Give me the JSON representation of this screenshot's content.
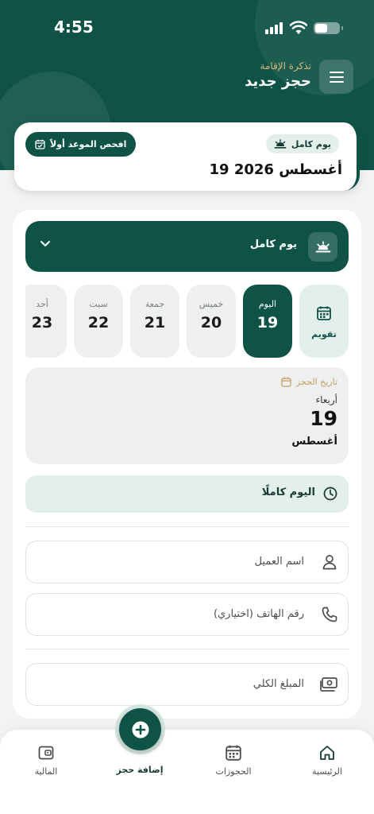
{
  "status_bar": {
    "time": "4:55"
  },
  "header": {
    "subtitle": "تذكرة الإقامة",
    "title": "حجز جديد"
  },
  "summary": {
    "chip_label": "يوم كامل",
    "check_button": "افحص الموعد أولاً",
    "date": "19 أغسطس 2026"
  },
  "booking_type": {
    "label": "يوم كامل"
  },
  "days": [
    {
      "name": "تقويم",
      "number": ""
    },
    {
      "name": "اليوم",
      "number": "19"
    },
    {
      "name": "خميس",
      "number": "20"
    },
    {
      "name": "جمعة",
      "number": "21"
    },
    {
      "name": "سبت",
      "number": "22"
    },
    {
      "name": "أحد",
      "number": "23"
    }
  ],
  "date_box": {
    "label": "تاريخ الحجز",
    "weekday": "أربعاء",
    "day": "19",
    "month": "أغسطس"
  },
  "time_slot": {
    "label": "اليوم كاملًا"
  },
  "fields": {
    "customer_name": "اسم العميل",
    "phone": "رقم الهاتف (اختياري)",
    "total_amount": "المبلغ الكلي"
  },
  "bottom_nav": {
    "home": "الرئيسية",
    "bookings": "الحجوزات",
    "add_booking": "إضافة حجز",
    "finance": "المالية"
  },
  "colors": {
    "primary": "#0f5347",
    "accent": "#c4a063",
    "light": "#e3efeb"
  }
}
